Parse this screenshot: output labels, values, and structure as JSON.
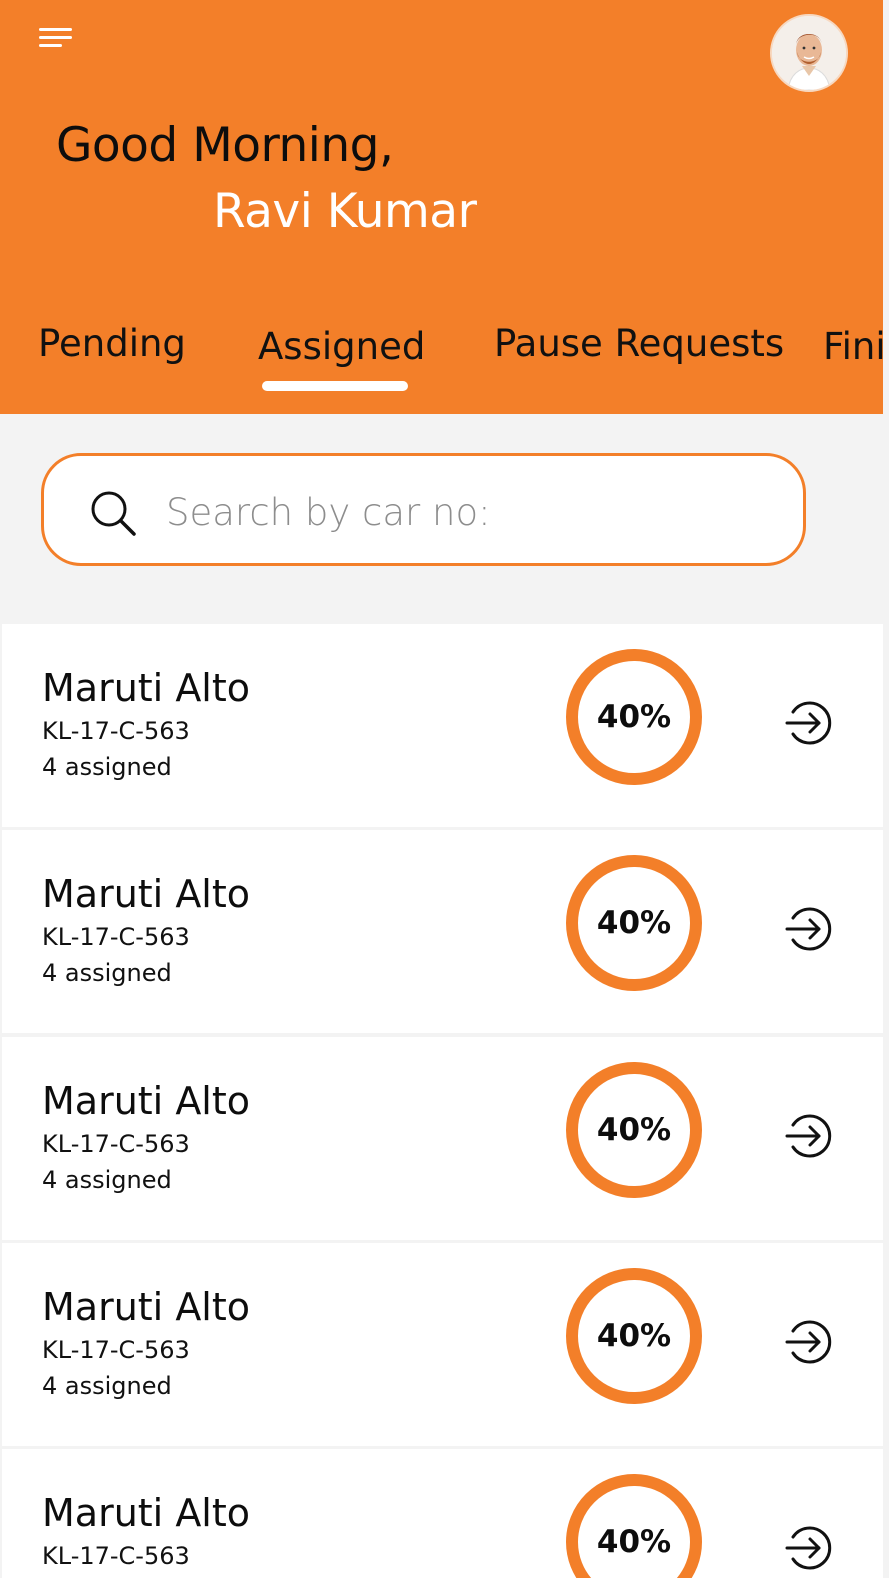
{
  "header": {
    "greeting": "Good Morning,",
    "user_name": "Ravi Kumar",
    "menu_icon": "hamburger-menu-icon",
    "avatar": "user-avatar"
  },
  "tabs": [
    {
      "label": "Pending",
      "active": false
    },
    {
      "label": "Assigned",
      "active": true
    },
    {
      "label": "Pause Requests",
      "active": false
    },
    {
      "label": "Fini",
      "active": false
    }
  ],
  "search": {
    "placeholder": "Search by car no:",
    "value": "",
    "icon": "search-icon"
  },
  "cars": [
    {
      "name": "Maruti Alto",
      "number": "KL-17-C-563",
      "assigned": "4 assigned",
      "progress": "40%"
    },
    {
      "name": "Maruti Alto",
      "number": "KL-17-C-563",
      "assigned": "4 assigned",
      "progress": "40%"
    },
    {
      "name": "Maruti Alto",
      "number": "KL-17-C-563",
      "assigned": "4 assigned",
      "progress": "40%"
    },
    {
      "name": "Maruti Alto",
      "number": "KL-17-C-563",
      "assigned": "4 assigned",
      "progress": "40%"
    },
    {
      "name": "Maruti Alto",
      "number": "KL-17-C-563",
      "assigned": "",
      "progress": "40%"
    }
  ],
  "colors": {
    "accent": "#F37F29",
    "background": "#F3F3F3",
    "card": "#FFFFFF"
  }
}
